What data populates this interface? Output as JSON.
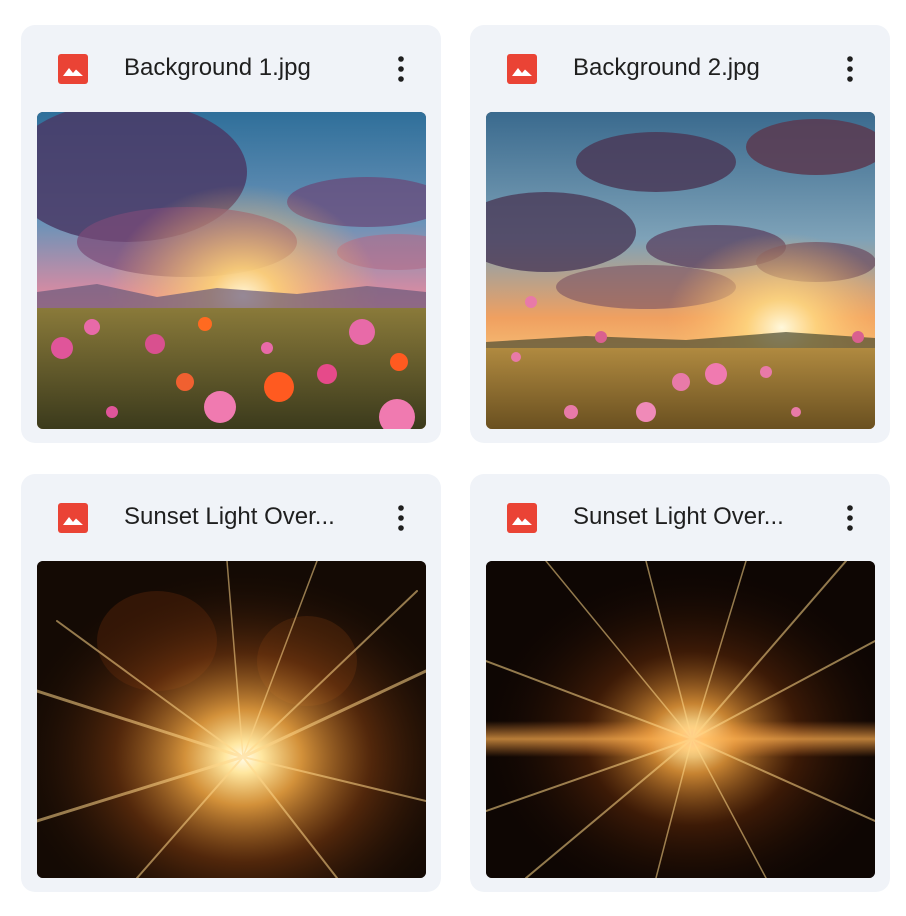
{
  "files": [
    {
      "name": "Background 1.jpg",
      "icon": "image-file-icon",
      "thumbnail": "sunset-flower-field"
    },
    {
      "name": "Background 2.jpg",
      "icon": "image-file-icon",
      "thumbnail": "sunset-cloud-meadow"
    },
    {
      "name": "Sunset Light Over...",
      "icon": "image-file-icon",
      "thumbnail": "golden-light-burst"
    },
    {
      "name": "Sunset Light Over...",
      "icon": "image-file-icon",
      "thumbnail": "golden-light-rays"
    }
  ],
  "colors": {
    "card_background": "#f0f3f8",
    "file_icon": "#ea4335",
    "text": "#1f1f1f"
  }
}
